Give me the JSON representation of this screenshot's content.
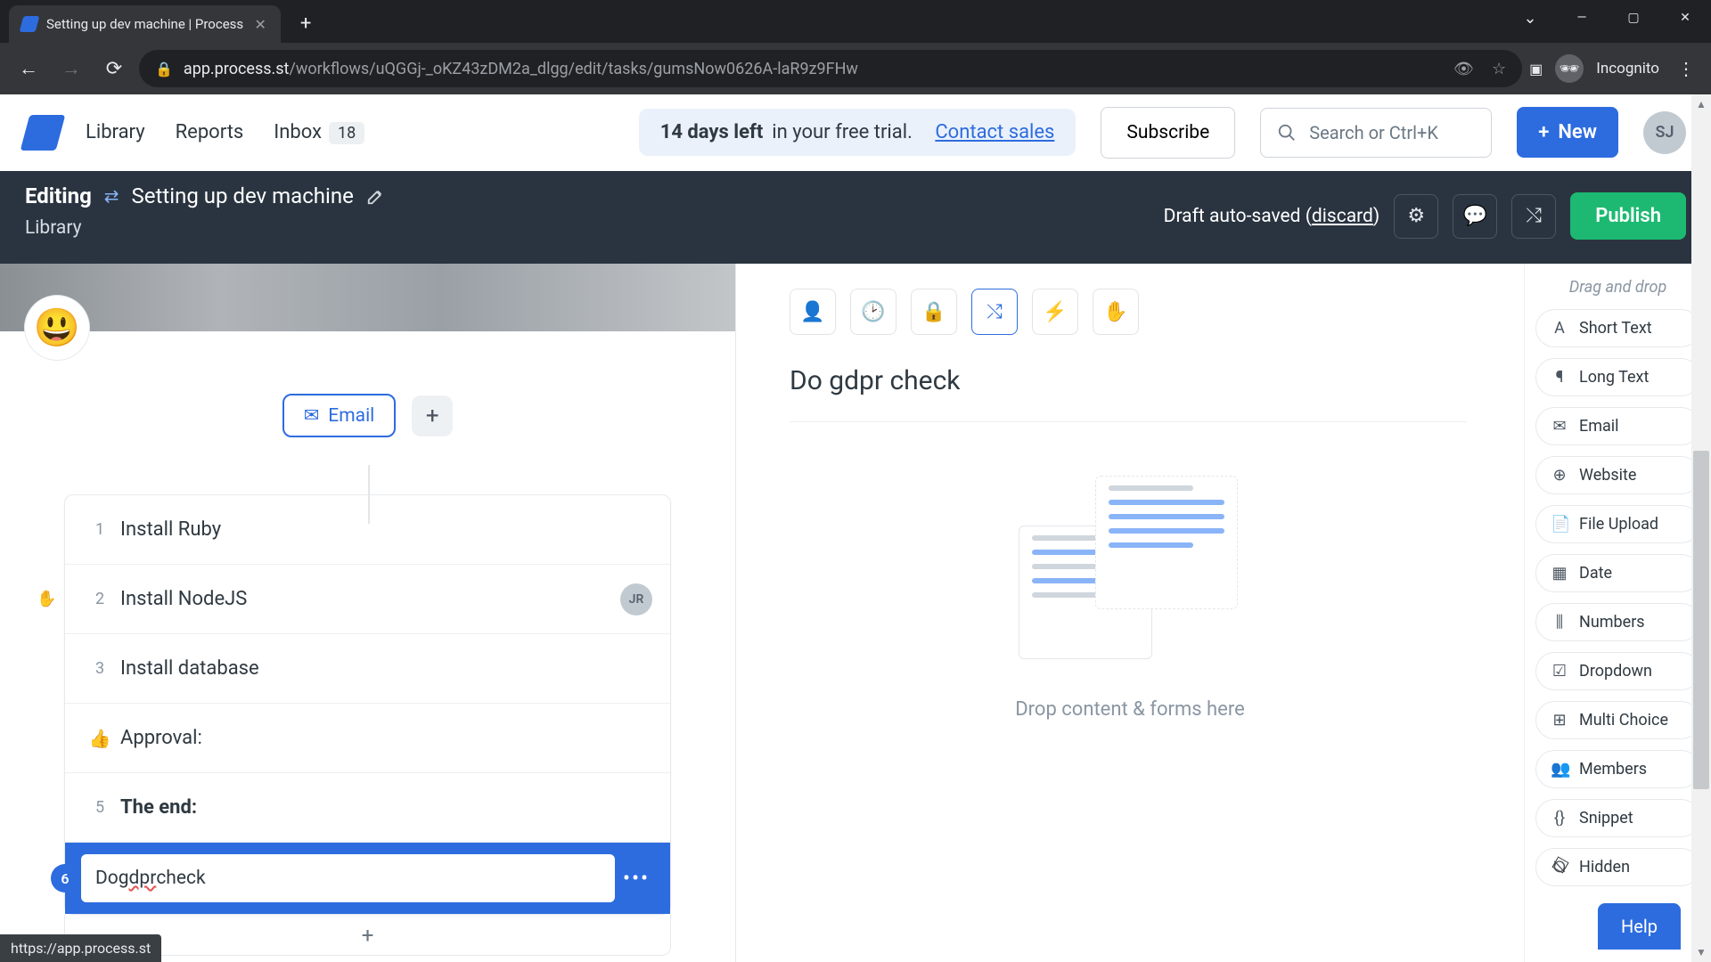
{
  "browser": {
    "tab_title": "Setting up dev machine | Process",
    "url_host": "app.process.st",
    "url_path": "/workflows/uQGGj-_oKZ43zDM2a_dlgg/edit/tasks/gumsNow0626A-laR9z9FHw",
    "incognito_label": "Incognito",
    "status_link": "https://app.process.st"
  },
  "topnav": {
    "library": "Library",
    "reports": "Reports",
    "inbox": "Inbox",
    "inbox_count": "18",
    "trial_bold": "14 days left",
    "trial_rest": "in your free trial.",
    "contact_sales": "Contact sales",
    "subscribe": "Subscribe",
    "search_placeholder": "Search or Ctrl+K",
    "new": "New",
    "avatar_initials": "SJ"
  },
  "editing": {
    "label": "Editing",
    "workflow_name": "Setting up dev machine",
    "breadcrumb": "Library",
    "draft_text": "Draft auto-saved (",
    "discard": "discard",
    "draft_close": ")",
    "publish": "Publish"
  },
  "left": {
    "emoji": "😃",
    "email_tab": "Email",
    "tasks": [
      {
        "num": "1",
        "title": "Install Ruby"
      },
      {
        "num": "2",
        "title": "Install NodeJS",
        "assignee": "JR"
      },
      {
        "num": "3",
        "title": "Install database"
      },
      {
        "icon": "approval",
        "title": "Approval:"
      },
      {
        "num": "5",
        "title": "The end:",
        "bold": true
      },
      {
        "num": "6",
        "title_pre": "Do ",
        "title_spell": "gdpr",
        "title_post": " check",
        "selected": true
      }
    ],
    "more_dots": "•••"
  },
  "center": {
    "title": "Do gdpr check",
    "drop_text": "Drop content & forms here"
  },
  "palette": {
    "title": "Drag and drop",
    "items": [
      {
        "icon": "A",
        "label": "Short Text"
      },
      {
        "icon": "¶",
        "label": "Long Text"
      },
      {
        "icon": "✉",
        "label": "Email"
      },
      {
        "icon": "⊕",
        "label": "Website"
      },
      {
        "icon": "📄",
        "label": "File Upload"
      },
      {
        "icon": "▦",
        "label": "Date"
      },
      {
        "icon": "⫼",
        "label": "Numbers"
      },
      {
        "icon": "☑",
        "label": "Dropdown"
      },
      {
        "icon": "⊞",
        "label": "Multi Choice"
      },
      {
        "icon": "👥",
        "label": "Members"
      },
      {
        "icon": "{}",
        "label": "Snippet"
      },
      {
        "icon": "⦰",
        "label": "Hidden"
      }
    ]
  },
  "help": "Help",
  "colors": {
    "accent": "#2d6cdf",
    "green": "#1db972"
  }
}
